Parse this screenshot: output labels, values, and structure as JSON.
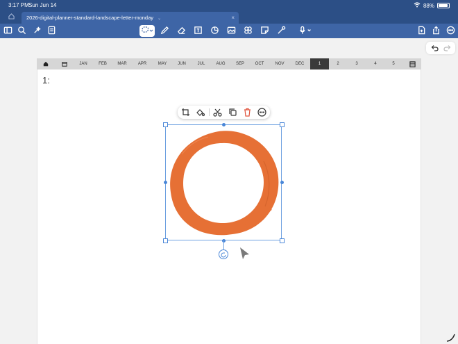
{
  "status_bar": {
    "time": "3:17 PM",
    "date": "Sun Jun 14",
    "battery": "88%"
  },
  "tabs": {
    "document_title": "2026-digital-planner-standard-landscape-letter-monday"
  },
  "toolbar": {
    "left_icons": [
      "sidebar-icon",
      "search-icon",
      "sparkle-icon",
      "outline-icon"
    ],
    "center_icons": [
      "lasso-icon",
      "pen-icon",
      "eraser-icon",
      "text-box-icon",
      "shapes-icon",
      "image-icon",
      "sticker-icon",
      "sticky-note-icon",
      "laser-pointer-icon",
      "microphone-icon"
    ],
    "right_icons": [
      "add-page-icon",
      "share-icon",
      "more-icon"
    ]
  },
  "planner_nav": {
    "months": [
      "JAN",
      "FEB",
      "MAR",
      "APR",
      "MAY",
      "JUN",
      "JUL",
      "AUG",
      "SEP",
      "OCT",
      "NOV",
      "DEC"
    ],
    "weeks": [
      "1",
      "2",
      "3",
      "4",
      "5"
    ],
    "active_week": "1"
  },
  "page": {
    "label": "1:"
  },
  "context_menu": {
    "actions": [
      "crop-icon",
      "color-icon",
      "cut-icon",
      "copy-icon",
      "delete-icon",
      "more-icon"
    ]
  },
  "image": {
    "description_color": "#e67035"
  },
  "colors": {
    "brand": "#3e65a6",
    "status_bar": "#2c4f86",
    "selection": "#4a87d8",
    "delete": "#e0533c",
    "brush": "#e67035"
  }
}
